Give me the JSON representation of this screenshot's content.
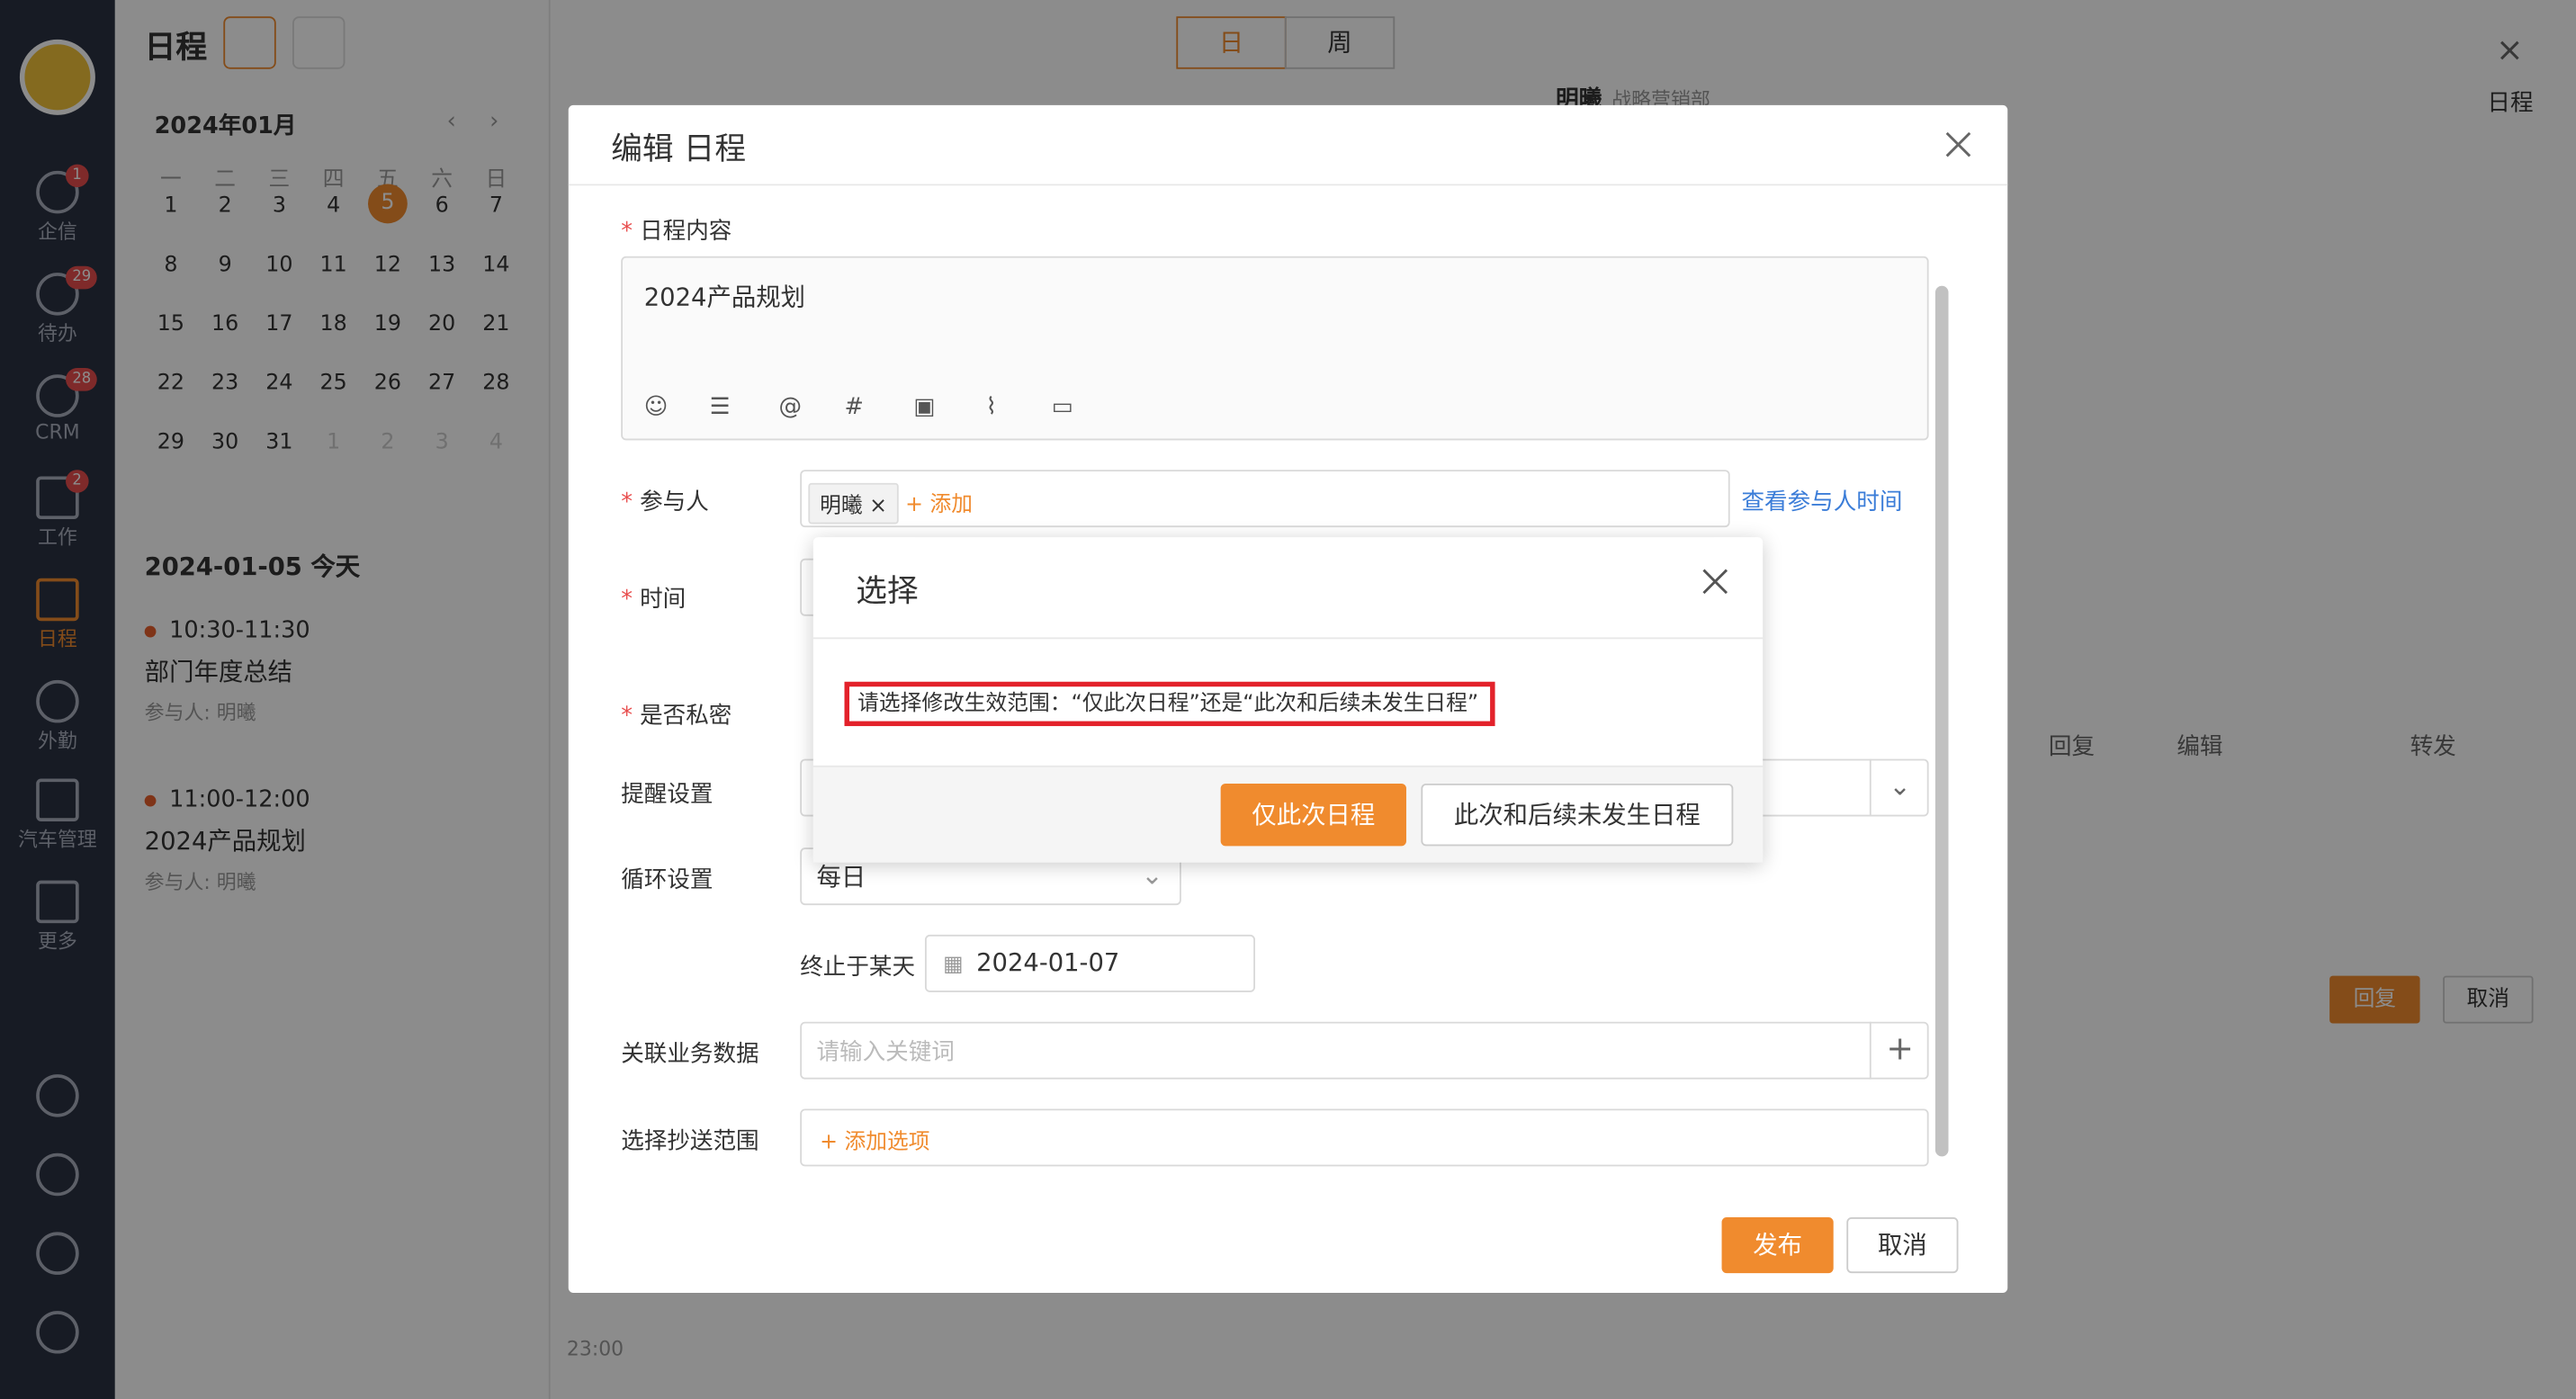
{
  "sidebar": {
    "items": [
      {
        "label": "企信",
        "badge": "1"
      },
      {
        "label": "待办",
        "badge": "29"
      },
      {
        "label": "CRM",
        "badge": "28"
      },
      {
        "label": "工作",
        "badge": "2"
      },
      {
        "label": "日程",
        "badge": ""
      },
      {
        "label": "外勤",
        "badge": ""
      },
      {
        "label": "汽车管理",
        "badge": ""
      },
      {
        "label": "更多",
        "badge": ""
      }
    ],
    "bottom_icons": [
      "help-icon",
      "clock-icon",
      "settings-icon",
      "user-icon"
    ]
  },
  "calendar": {
    "title": "日程",
    "month": "2024年01月",
    "weekdays": [
      "一",
      "二",
      "三",
      "四",
      "五",
      "六",
      "日"
    ],
    "weeks": [
      [
        "1",
        "2",
        "3",
        "4",
        "5",
        "6",
        "7"
      ],
      [
        "8",
        "9",
        "10",
        "11",
        "12",
        "13",
        "14"
      ],
      [
        "15",
        "16",
        "17",
        "18",
        "19",
        "20",
        "21"
      ],
      [
        "22",
        "23",
        "24",
        "25",
        "26",
        "27",
        "28"
      ],
      [
        "29",
        "30",
        "31",
        "1",
        "2",
        "3",
        "4"
      ]
    ],
    "today_label": "2024-01-05 今天",
    "events": [
      {
        "time": "10:30-11:30",
        "title": "部门年度总结",
        "participants": "参与人: 明曦"
      },
      {
        "time": "11:00-12:00",
        "title": "2024产品规划",
        "participants": "参与人: 明曦"
      }
    ]
  },
  "main": {
    "view_day": "日",
    "view_week": "周",
    "time_label": "23:00"
  },
  "right_panel": {
    "title": "日程",
    "user": "明曦",
    "dept": "战略营销部",
    "actions": [
      "回复",
      "编辑",
      "转发"
    ],
    "reply_btn": "回复",
    "cancel_btn": "取消"
  },
  "edit_dialog": {
    "title": "编辑 日程",
    "content_label": "日程内容",
    "content_value": "2024产品规划",
    "participants_label": "参与人",
    "participant_tag": "明曦",
    "add_participant": "+ 添加",
    "view_time_link": "查看参与人时间",
    "time_label": "时间",
    "private_label": "是否私密",
    "reminder_label": "提醒设置",
    "repeat_label": "循环设置",
    "repeat_value": "每日",
    "end_label": "终止于某天",
    "end_value": "2024-01-07",
    "related_label": "关联业务数据",
    "related_placeholder": "请输入关键词",
    "cc_label": "选择抄送范围",
    "cc_add": "+ 添加选项",
    "publish_btn": "发布",
    "cancel_btn": "取消"
  },
  "select_dialog": {
    "title": "选择",
    "message": "请选择修改生效范围：“仅此次日程”还是“此次和后续未发生日程”",
    "btn_once": "仅此次日程",
    "btn_future": "此次和后续未发生日程"
  },
  "colors": {
    "accent": "#f08b2e",
    "sidebar_bg": "#2b3243",
    "highlight_border": "#e3222b",
    "link": "#3b7dd8"
  }
}
